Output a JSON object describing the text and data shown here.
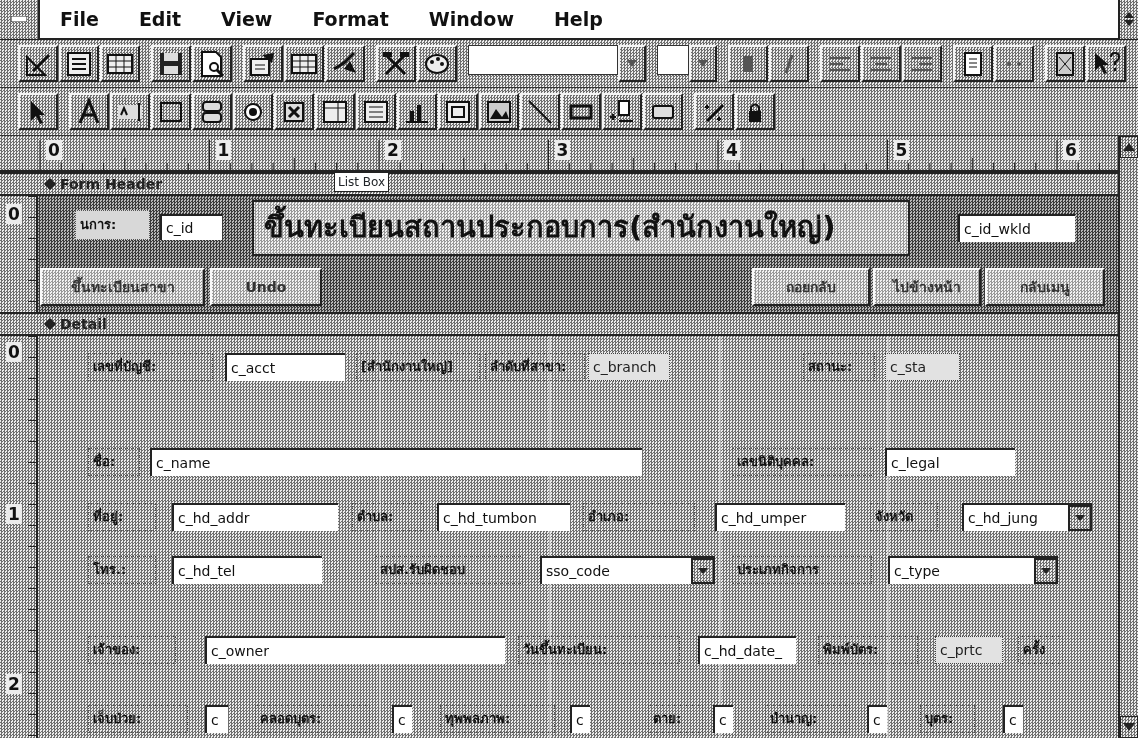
{
  "menu": [
    {
      "label": "File"
    },
    {
      "label": "Edit"
    },
    {
      "label": "View"
    },
    {
      "label": "Format"
    },
    {
      "label": "Window"
    },
    {
      "label": "Help"
    }
  ],
  "ruler": [
    "0",
    "1",
    "2",
    "3",
    "4",
    "5",
    "6"
  ],
  "tooltip": "List Box",
  "form_header": {
    "title": "Form Header",
    "v_ruler": [
      "0"
    ],
    "controls": [
      {
        "kind": "label",
        "text": "นการ:"
      },
      {
        "kind": "field",
        "text": "c_id",
        "disabled": false
      },
      {
        "kind": "title",
        "text": "ขึ้นทะเบียนสถานประกอบการ(สำนักงานใหญ่)"
      },
      {
        "kind": "field",
        "text": "c_id_wkld",
        "disabled": false
      },
      {
        "kind": "button",
        "text": "ขึ้นทะเบียนสาขา"
      },
      {
        "kind": "button",
        "text": "Undo"
      },
      {
        "kind": "button",
        "text": "ถอยกลับ"
      },
      {
        "kind": "button",
        "text": "ไปข้างหน้า"
      },
      {
        "kind": "button",
        "text": "กลับเมนู"
      }
    ]
  },
  "detail": {
    "title": "Detail",
    "v_ruler": [
      "0",
      "1",
      "2"
    ],
    "controls": [
      {
        "kind": "label",
        "text": "เลขที่บัญชี:"
      },
      {
        "kind": "field",
        "text": "c_acct",
        "disabled": false
      },
      {
        "kind": "label",
        "text": "[สำนักงานใหญ่]"
      },
      {
        "kind": "label",
        "text": "ลำดับที่สาขา:"
      },
      {
        "kind": "field",
        "text": "c_branch",
        "disabled": true
      },
      {
        "kind": "label",
        "text": "สถานะ:"
      },
      {
        "kind": "field",
        "text": "c_sta",
        "disabled": true
      },
      {
        "kind": "label",
        "text": "ชื่อ:"
      },
      {
        "kind": "field",
        "text": "c_name",
        "disabled": false
      },
      {
        "kind": "label",
        "text": "เลขนิติบุคคล:"
      },
      {
        "kind": "field",
        "text": "c_legal",
        "disabled": false
      },
      {
        "kind": "label",
        "text": "ที่อยู่:"
      },
      {
        "kind": "field",
        "text": "c_hd_addr",
        "disabled": false
      },
      {
        "kind": "label",
        "text": "ตำบล:"
      },
      {
        "kind": "field",
        "text": "c_hd_tumbon",
        "disabled": false
      },
      {
        "kind": "label",
        "text": "อำเภอ:"
      },
      {
        "kind": "field",
        "text": "c_hd_umper",
        "disabled": false
      },
      {
        "kind": "label",
        "text": "จังหวัด"
      },
      {
        "kind": "combo",
        "text": "c_hd_jung",
        "disabled": false
      },
      {
        "kind": "label",
        "text": "โทร.:"
      },
      {
        "kind": "field",
        "text": "c_hd_tel",
        "disabled": false
      },
      {
        "kind": "label",
        "text": "สปส.รับผิดชอบ"
      },
      {
        "kind": "combo",
        "text": "sso_code",
        "disabled": false
      },
      {
        "kind": "label",
        "text": "ประเภทกิจการ"
      },
      {
        "kind": "combo",
        "text": "c_type",
        "disabled": false
      },
      {
        "kind": "label",
        "text": "เจ้าของ:"
      },
      {
        "kind": "field",
        "text": "c_owner",
        "disabled": false
      },
      {
        "kind": "label",
        "text": "วันขึ้นทะเบียน:"
      },
      {
        "kind": "field",
        "text": "c_hd_date_",
        "disabled": false
      },
      {
        "kind": "label",
        "text": "พิมพ์บัตร:"
      },
      {
        "kind": "field",
        "text": "c_prtc",
        "disabled": true
      },
      {
        "kind": "label",
        "text": "ครั้ง"
      },
      {
        "kind": "label",
        "text": "เจ็บป่วย:"
      },
      {
        "kind": "field",
        "text": "c",
        "disabled": false
      },
      {
        "kind": "label",
        "text": "คลอดบุตร:"
      },
      {
        "kind": "field",
        "text": "c",
        "disabled": false
      },
      {
        "kind": "label",
        "text": "ทุพพลภาพ:"
      },
      {
        "kind": "field",
        "text": "c",
        "disabled": false
      },
      {
        "kind": "label",
        "text": "ตาย:"
      },
      {
        "kind": "field",
        "text": "c",
        "disabled": false
      },
      {
        "kind": "label",
        "text": "บำนาญ:"
      },
      {
        "kind": "field",
        "text": "c",
        "disabled": false
      },
      {
        "kind": "label",
        "text": "บุตร:"
      },
      {
        "kind": "field",
        "text": "c",
        "disabled": false
      }
    ]
  }
}
